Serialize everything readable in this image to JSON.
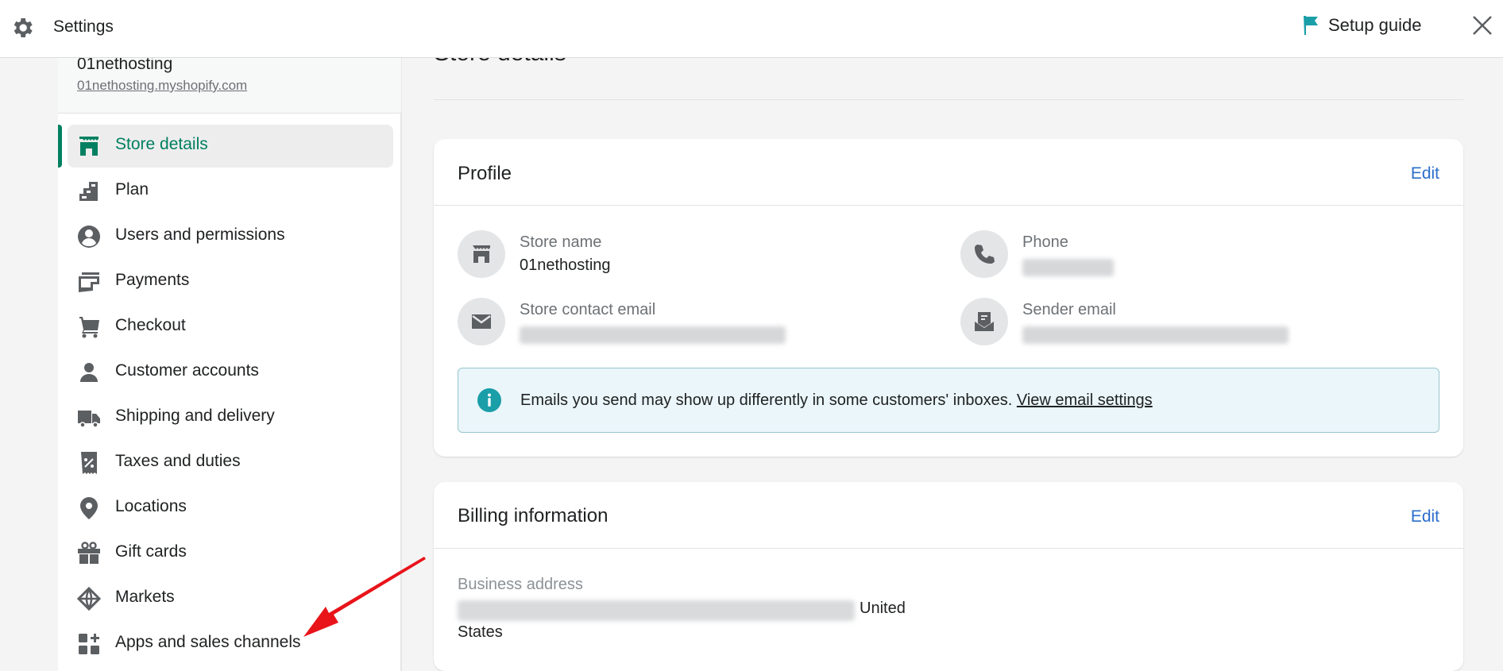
{
  "topbar": {
    "title": "Settings",
    "setup_guide_label": "Setup guide",
    "icons": {
      "settings": "gear-icon",
      "setup": "flag-icon",
      "close": "close-icon"
    },
    "accent_color": "#1a9ea8"
  },
  "sidebar": {
    "store_name": "01nethosting",
    "store_url": "01nethosting.myshopify.com",
    "active_color": "#008060",
    "items": [
      {
        "label": "Store details",
        "icon": "store-icon",
        "active": true
      },
      {
        "label": "Plan",
        "icon": "plan-icon",
        "active": false
      },
      {
        "label": "Users and permissions",
        "icon": "user-circle-icon",
        "active": false
      },
      {
        "label": "Payments",
        "icon": "payments-icon",
        "active": false
      },
      {
        "label": "Checkout",
        "icon": "cart-icon",
        "active": false
      },
      {
        "label": "Customer accounts",
        "icon": "person-icon",
        "active": false
      },
      {
        "label": "Shipping and delivery",
        "icon": "truck-icon",
        "active": false
      },
      {
        "label": "Taxes and duties",
        "icon": "tax-receipt-icon",
        "active": false
      },
      {
        "label": "Locations",
        "icon": "location-pin-icon",
        "active": false
      },
      {
        "label": "Gift cards",
        "icon": "gift-icon",
        "active": false
      },
      {
        "label": "Markets",
        "icon": "globe-icon",
        "active": false
      },
      {
        "label": "Apps and sales channels",
        "icon": "apps-icon",
        "active": false
      }
    ]
  },
  "main": {
    "page_title": "Store details",
    "profile": {
      "title": "Profile",
      "edit_label": "Edit",
      "fields": {
        "store_name": {
          "label": "Store name",
          "value": "01nethosting"
        },
        "phone": {
          "label": "Phone",
          "value": "(redacted)"
        },
        "contact_email": {
          "label": "Store contact email",
          "value": "(redacted)"
        },
        "sender_email": {
          "label": "Sender email",
          "value": "(redacted)"
        }
      },
      "banner": {
        "message": "Emails you send may show up differently in some customers' inboxes. ",
        "link": "View email settings"
      }
    },
    "billing": {
      "title": "Billing information",
      "edit_label": "Edit",
      "address_label": "Business address",
      "address_country_1": "United",
      "address_country_2": "States"
    }
  },
  "annotation": {
    "type": "arrow",
    "color": "#e8141a",
    "points_to": "Apps and sales channels"
  }
}
